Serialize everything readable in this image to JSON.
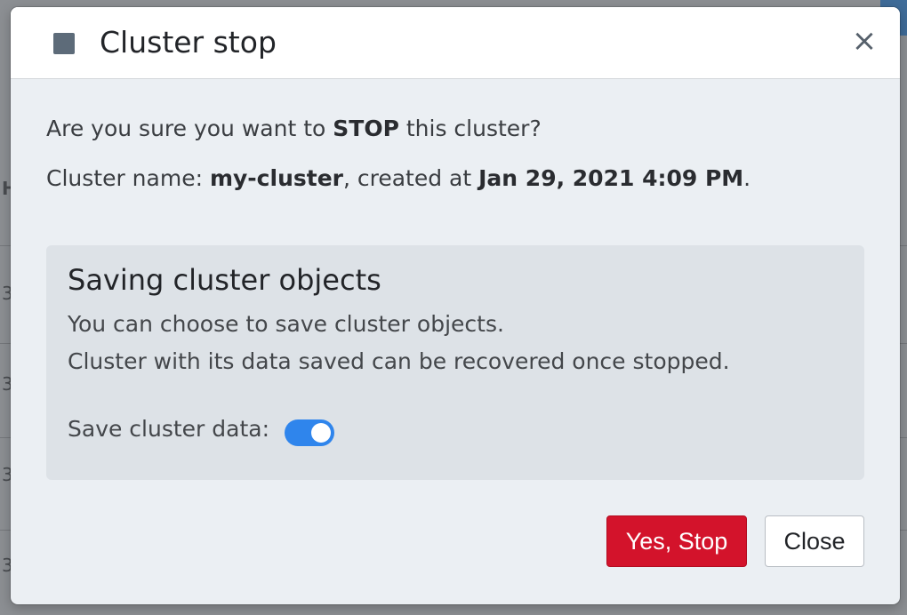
{
  "dialog": {
    "title": "Cluster stop",
    "close_icon": "×",
    "confirm": {
      "prefix": "Are you sure you want to ",
      "action": "STOP",
      "suffix": " this cluster?"
    },
    "cluster_info": {
      "label": "Cluster name: ",
      "name": "my-cluster",
      "created_text": ", created at ",
      "created_at": "Jan 29, 2021 4:09 PM",
      "end": "."
    },
    "saving": {
      "title": "Saving cluster objects",
      "text1": "You can choose to save cluster objects.",
      "text2": "Cluster with its data saved can be recovered once stopped.",
      "toggle_label": "Save cluster data:",
      "toggle_on": true
    },
    "buttons": {
      "stop": "Yes, Stop",
      "close": "Close"
    }
  },
  "colors": {
    "danger": "#d3132b",
    "toggle_on": "#2f85ec",
    "stop_icon": "#5d6b79"
  },
  "icons": {
    "header": "stop-square-icon",
    "close": "close-icon"
  },
  "background": {
    "fragments": [
      "H",
      "3",
      "3",
      "3",
      "3"
    ]
  }
}
